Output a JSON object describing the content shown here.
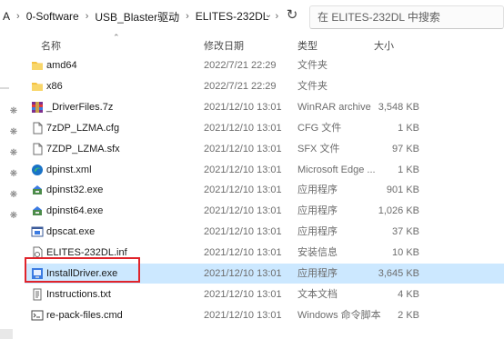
{
  "address_bar": {
    "crumbs": [
      "A",
      "0-Software",
      "USB_Blaster驱动",
      "ELITES-232DL"
    ],
    "separator": "›"
  },
  "search": {
    "placeholder": "在 ELITES-232DL 中搜索"
  },
  "columns": {
    "name": "名称",
    "date": "修改日期",
    "type": "类型",
    "size": "大小"
  },
  "files": [
    {
      "name": "amd64",
      "date": "2022/7/21 22:29",
      "type": "文件夹",
      "size": "",
      "icon": "folder-icon",
      "selected": false
    },
    {
      "name": "x86",
      "date": "2022/7/21 22:29",
      "type": "文件夹",
      "size": "",
      "icon": "folder-icon",
      "selected": false
    },
    {
      "name": "_DriverFiles.7z",
      "date": "2021/12/10 13:01",
      "type": "WinRAR archive",
      "size": "3,548 KB",
      "icon": "winrar-archive-icon",
      "selected": false
    },
    {
      "name": "7zDP_LZMA.cfg",
      "date": "2021/12/10 13:01",
      "type": "CFG 文件",
      "size": "1 KB",
      "icon": "file-icon",
      "selected": false
    },
    {
      "name": "7ZDP_LZMA.sfx",
      "date": "2021/12/10 13:01",
      "type": "SFX 文件",
      "size": "97 KB",
      "icon": "file-icon",
      "selected": false
    },
    {
      "name": "dpinst.xml",
      "date": "2021/12/10 13:01",
      "type": "Microsoft Edge ...",
      "size": "1 KB",
      "icon": "edge-icon",
      "selected": false
    },
    {
      "name": "dpinst32.exe",
      "date": "2021/12/10 13:01",
      "type": "应用程序",
      "size": "901 KB",
      "icon": "installer-icon",
      "selected": false
    },
    {
      "name": "dpinst64.exe",
      "date": "2021/12/10 13:01",
      "type": "应用程序",
      "size": "1,026 KB",
      "icon": "installer-icon",
      "selected": false
    },
    {
      "name": "dpscat.exe",
      "date": "2021/12/10 13:01",
      "type": "应用程序",
      "size": "37 KB",
      "icon": "app-icon",
      "selected": false
    },
    {
      "name": "ELITES-232DL.inf",
      "date": "2021/12/10 13:01",
      "type": "安装信息",
      "size": "10 KB",
      "icon": "setup-info-icon",
      "selected": false
    },
    {
      "name": "InstallDriver.exe",
      "date": "2021/12/10 13:01",
      "type": "应用程序",
      "size": "3,645 KB",
      "icon": "installdriver-icon",
      "selected": true
    },
    {
      "name": "Instructions.txt",
      "date": "2021/12/10 13:01",
      "type": "文本文档",
      "size": "4 KB",
      "icon": "text-file-icon",
      "selected": false
    },
    {
      "name": "re-pack-files.cmd",
      "date": "2021/12/10 13:01",
      "type": "Windows 命令脚本",
      "size": "2 KB",
      "icon": "cmd-script-icon",
      "selected": false
    }
  ],
  "colors": {
    "selection": "#cce8ff",
    "highlight_box": "#e0242b",
    "folder": "#f5c242"
  }
}
